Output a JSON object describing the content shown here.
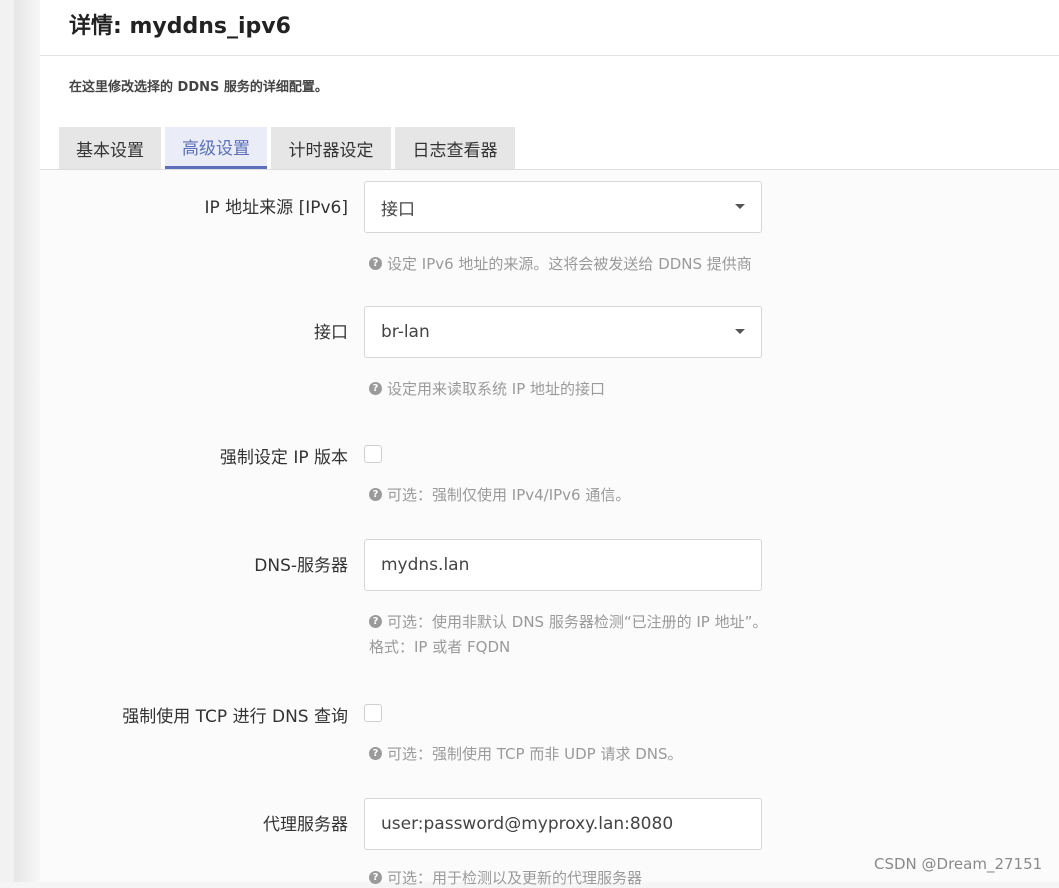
{
  "title": "详情: myddns_ipv6",
  "description": "在这里修改选择的 DDNS 服务的详细配置。",
  "tabs": [
    {
      "label": "基本设置",
      "active": false
    },
    {
      "label": "高级设置",
      "active": true
    },
    {
      "label": "计时器设定",
      "active": false
    },
    {
      "label": "日志查看器",
      "active": false
    }
  ],
  "fields": {
    "ip_source": {
      "label": "IP 地址来源 [IPv6]",
      "value": "接口",
      "help": "设定 IPv6 地址的来源。这将会被发送给 DDNS 提供商"
    },
    "interface": {
      "label": "接口",
      "value": "br-lan",
      "help": "设定用来读取系统 IP 地址的接口"
    },
    "force_ip_version": {
      "label": "强制设定 IP 版本",
      "checked": false,
      "help": "可选：强制仅使用 IPv4/IPv6 通信。"
    },
    "dns_server": {
      "label": "DNS-服务器",
      "value": "mydns.lan",
      "help": "可选：使用非默认 DNS 服务器检测“已注册的 IP 地址”。",
      "help_line2": "格式：IP 或者 FQDN"
    },
    "force_tcp": {
      "label": "强制使用 TCP 进行 DNS 查询",
      "checked": false,
      "help": "可选：强制使用 TCP 而非 UDP 请求 DNS。"
    },
    "proxy": {
      "label": "代理服务器",
      "value": "user:password@myproxy.lan:8080",
      "help": "可选：用于检测以及更新的代理服务器"
    }
  },
  "help_icon": "question-circle-icon",
  "watermark": "CSDN @Dream_27151",
  "colors": {
    "accent": "#5b70b8",
    "help_text": "#9a9a9a"
  }
}
